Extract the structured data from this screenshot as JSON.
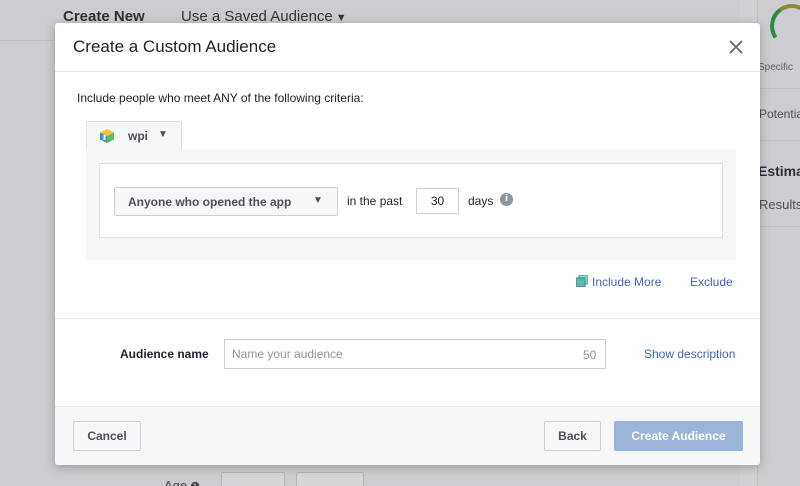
{
  "background": {
    "tabs": [
      {
        "label": "Create New"
      },
      {
        "label": "Use a Saved Audience"
      }
    ],
    "side": {
      "gauge_label": "Specific",
      "potential_label": "Potentia",
      "estimate_heading": "Estima",
      "results_label": "Results"
    },
    "age_label": "Age"
  },
  "modal": {
    "title": "Create a Custom Audience",
    "criteria_label": "Include people who meet ANY of the following criteria:",
    "app": {
      "name": "wpi",
      "icon": "app-cube-icon"
    },
    "rule": {
      "event_label": "Anyone who opened the app",
      "in_the_past": "in the past",
      "days_value": "30",
      "days_label": "days"
    },
    "include_more": "Include More",
    "exclude": "Exclude",
    "audience_name": {
      "label": "Audience name",
      "placeholder": "Name your audience",
      "value": "",
      "char_limit": "50"
    },
    "show_description": "Show description",
    "footer": {
      "cancel": "Cancel",
      "back": "Back",
      "create": "Create Audience"
    }
  },
  "colors": {
    "link": "#4267b2",
    "primary_disabled": "#9cb4d8",
    "panel_bg": "#f6f7f9"
  }
}
